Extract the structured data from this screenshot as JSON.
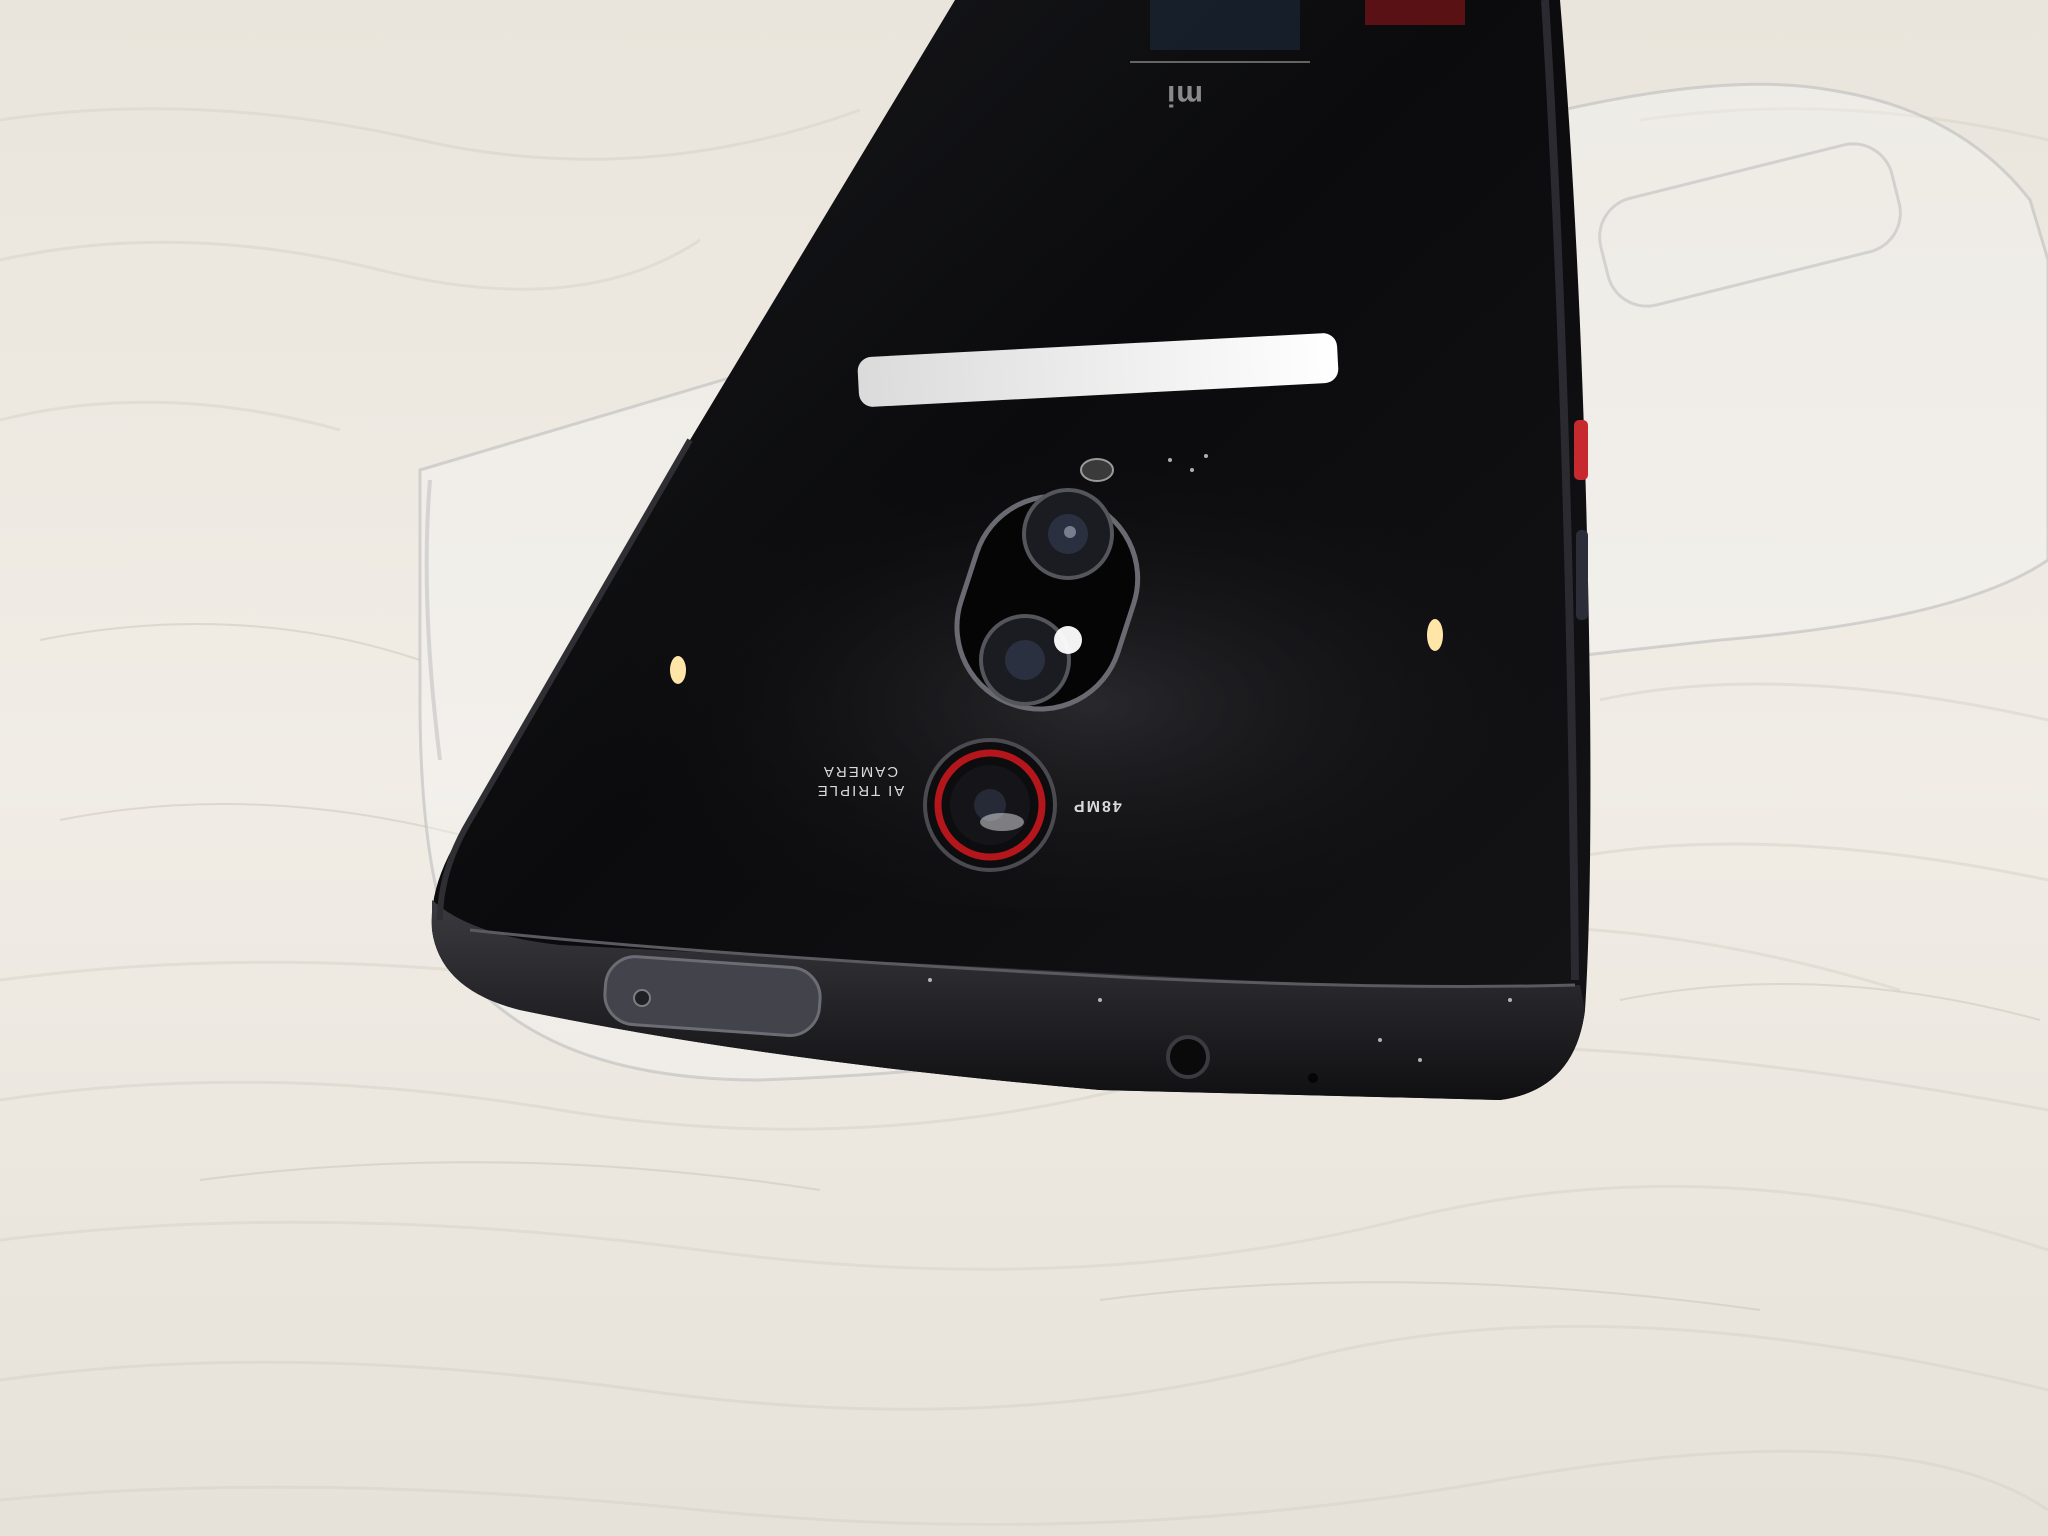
{
  "phone": {
    "brand_logo": "mi",
    "camera_label_line1": "AI TRIPLE",
    "camera_label_line2": "CAMERA",
    "megapixel_label": "48MP"
  },
  "colors": {
    "fur_background": "#ece8df",
    "phone_body": "#0f0f11",
    "camera_ring_accent": "#b5161c",
    "clear_case": "#f4f4f4"
  }
}
